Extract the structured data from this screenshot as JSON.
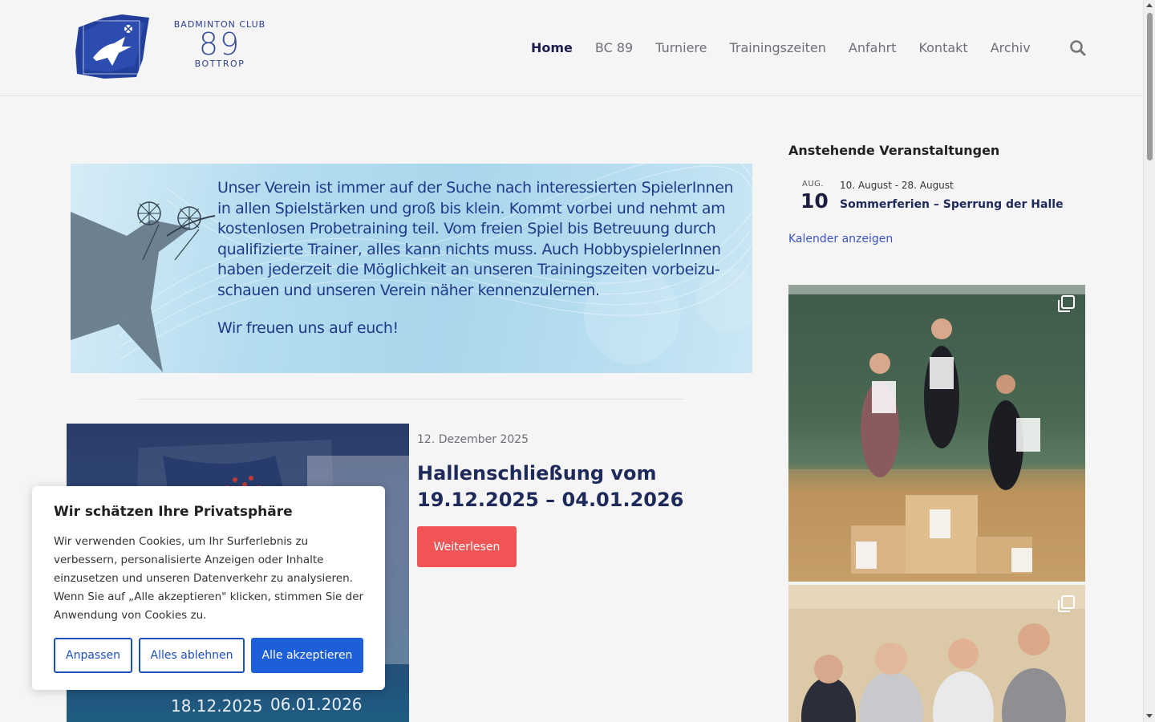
{
  "logo": {
    "club": "BADMINTON CLUB",
    "number": "89",
    "city": "BOTTROP"
  },
  "nav": {
    "items": [
      {
        "label": "Home",
        "active": true
      },
      {
        "label": "BC 89",
        "active": false
      },
      {
        "label": "Turniere",
        "active": false
      },
      {
        "label": "Trainingszeiten",
        "active": false
      },
      {
        "label": "Anfahrt",
        "active": false
      },
      {
        "label": "Kontakt",
        "active": false
      },
      {
        "label": "Archiv",
        "active": false
      }
    ],
    "search_icon": "search-icon"
  },
  "banner": {
    "paragraph1": "Unser Verein ist immer auf der Suche nach interessierten SpielerInnen in allen Spielstärken und groß bis klein. Kommt vorbei und nehmt am kostenlosen Probetraining teil. Vom freien Spiel bis Betreuung durch qualifizierte Trainer, alles kann nichts muss. Auch HobbyspielerInnen haben jederzeit die Möglichkeit an unseren Trainingszeiten vorbeizu-schauen und unseren Verein näher kennenzulernen.",
    "paragraph2": "Wir freuen uns auf euch!"
  },
  "post": {
    "date": "12. Dezember 2025",
    "title": "Hallenschließung vom 19.12.2025 – 04.01.2026",
    "read_more": "Weiterlesen",
    "image": {
      "date_left": "18.12.2025",
      "date_right": "06.01.2026"
    }
  },
  "sidebar": {
    "events_title": "Anstehende Veranstaltungen",
    "event": {
      "month": "AUG.",
      "day": "10",
      "range": "10. August - 28. August",
      "name": "Sommerferien – Sperrung der Halle"
    },
    "calendar_link": "Kalender anzeigen",
    "gallery_icon": "multiple-images-icon"
  },
  "cookie": {
    "title": "Wir schätzen Ihre Privatsphäre",
    "text": "Wir verwenden Cookies, um Ihr Surferlebnis zu verbessern, personalisierte Anzeigen oder Inhalte einzusetzen und unseren Datenverkehr zu analysieren. Wenn Sie auf „Alle akzeptieren\" klicken, stimmen Sie der Anwendung von Cookies zu.",
    "customize": "Anpassen",
    "reject": "Alles ablehnen",
    "accept": "Alle akzeptieren"
  },
  "colors": {
    "accent_red": "#f05454",
    "nav_active": "#1d1d4f",
    "link_blue": "#3b55c4",
    "cookie_blue": "#1d5fd8",
    "banner_text": "#203a8a"
  }
}
